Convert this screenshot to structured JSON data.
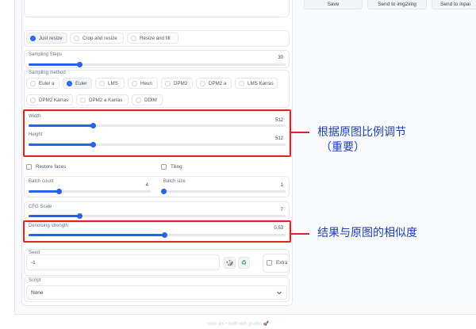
{
  "top_buttons": {
    "save": "Save",
    "img2img": "Send to img2img",
    "inpaint": "Send to inpai"
  },
  "resize_modes": [
    "Just resize",
    "Crop and resize",
    "Resize and fill"
  ],
  "sampling_steps": {
    "label": "Sampling Steps",
    "value": "30",
    "fraction": 0.2
  },
  "sampling_method": {
    "label": "Sampling method",
    "options": [
      "Euler a",
      "Euler",
      "LMS",
      "Heun",
      "DPM2",
      "DPM2 a",
      "LMS Karras",
      "DPM2 Karras",
      "DPM2 a Karras",
      "DDIM"
    ],
    "selected": "Euler"
  },
  "width": {
    "label": "Width",
    "value": "512",
    "fraction": 0.25
  },
  "height": {
    "label": "Height",
    "value": "512",
    "fraction": 0.25
  },
  "restore_faces": "Restore faces",
  "tiling": "Tiling",
  "batch_count": {
    "label": "Batch count",
    "value": "4",
    "fraction": 0.25
  },
  "batch_size": {
    "label": "Batch size",
    "value": "1",
    "fraction": 0.0
  },
  "cfg_scale": {
    "label": "CFG Scale",
    "value": "7",
    "fraction": 0.2
  },
  "denoising": {
    "label": "Denoising strength",
    "value": "0.53",
    "fraction": 0.53
  },
  "seed": {
    "label": "Seed",
    "value": "-1",
    "dice_icon": "🎲",
    "recycle_icon": "♻",
    "extra_label": "Extra"
  },
  "script": {
    "label": "Script",
    "value": "None"
  },
  "annotations": {
    "size_note_line1": "根据原图比例调节",
    "size_note_line2": "（重要）",
    "denoise_note": "结果与原图的相似度"
  },
  "footer": "view api • built with gradio 🚀",
  "colors": {
    "accent": "#2563eb",
    "highlight": "#e02424",
    "annotation_text": "#1e40af"
  }
}
